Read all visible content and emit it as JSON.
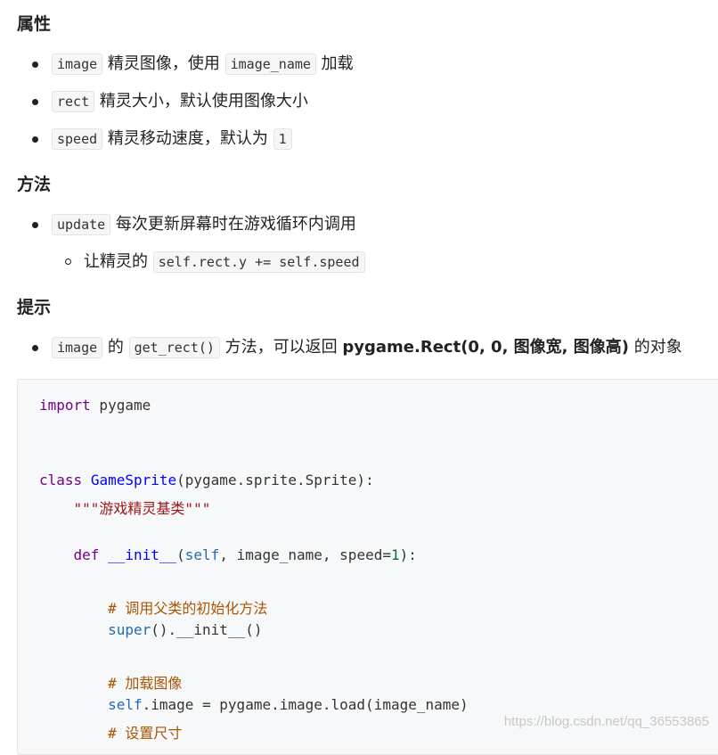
{
  "sections": {
    "attributes": {
      "title": "属性",
      "items": [
        {
          "code": "image",
          "text": "精灵图像，使用",
          "code2": "image_name",
          "text2": "加载"
        },
        {
          "code": "rect",
          "text": "精灵大小，默认使用图像大小"
        },
        {
          "code": "speed",
          "text": "精灵移动速度，默认为",
          "code2": "1"
        }
      ]
    },
    "methods": {
      "title": "方法",
      "items": [
        {
          "code": "update",
          "text": "每次更新屏幕时在游戏循环内调用"
        }
      ],
      "subitems": [
        {
          "text": "让精灵的",
          "code": "self.rect.y += self.speed"
        }
      ]
    },
    "tips": {
      "title": "提示",
      "items": [
        {
          "code": "image",
          "text": "的",
          "code2": "get_rect()",
          "text2": "方法，可以返回",
          "strong": "pygame.Rect(0, 0, 图像宽, 图像高)",
          "text3": "的对象"
        }
      ]
    }
  },
  "code": {
    "l1": {
      "kw": "import",
      "rest": " pygame"
    },
    "l2": {
      "kw": "class",
      "name": "GameSprite",
      "rest": "(pygame.sprite.Sprite):"
    },
    "l3": {
      "indent": "    ",
      "doc": "\"\"\"游戏精灵基类\"\"\""
    },
    "l4": {
      "indent": "    ",
      "kw": "def",
      "name": "__init__",
      "p1": "(",
      "self": "self",
      "p2": ", image_name, speed=",
      "num": "1",
      "p3": "):"
    },
    "l5": {
      "indent": "        ",
      "comment": "# 调用父类的初始化方法"
    },
    "l6": {
      "indent": "        ",
      "builtin": "super",
      "rest": "().__init__()"
    },
    "l7": {
      "indent": "        ",
      "comment": "# 加载图像"
    },
    "l8": {
      "indent": "        ",
      "self": "self",
      "rest": ".image = pygame.image.load(image_name)"
    },
    "l9": {
      "indent": "        ",
      "comment": "# 设置尺寸"
    }
  },
  "watermark": "https://blog.csdn.net/qq_36553865"
}
